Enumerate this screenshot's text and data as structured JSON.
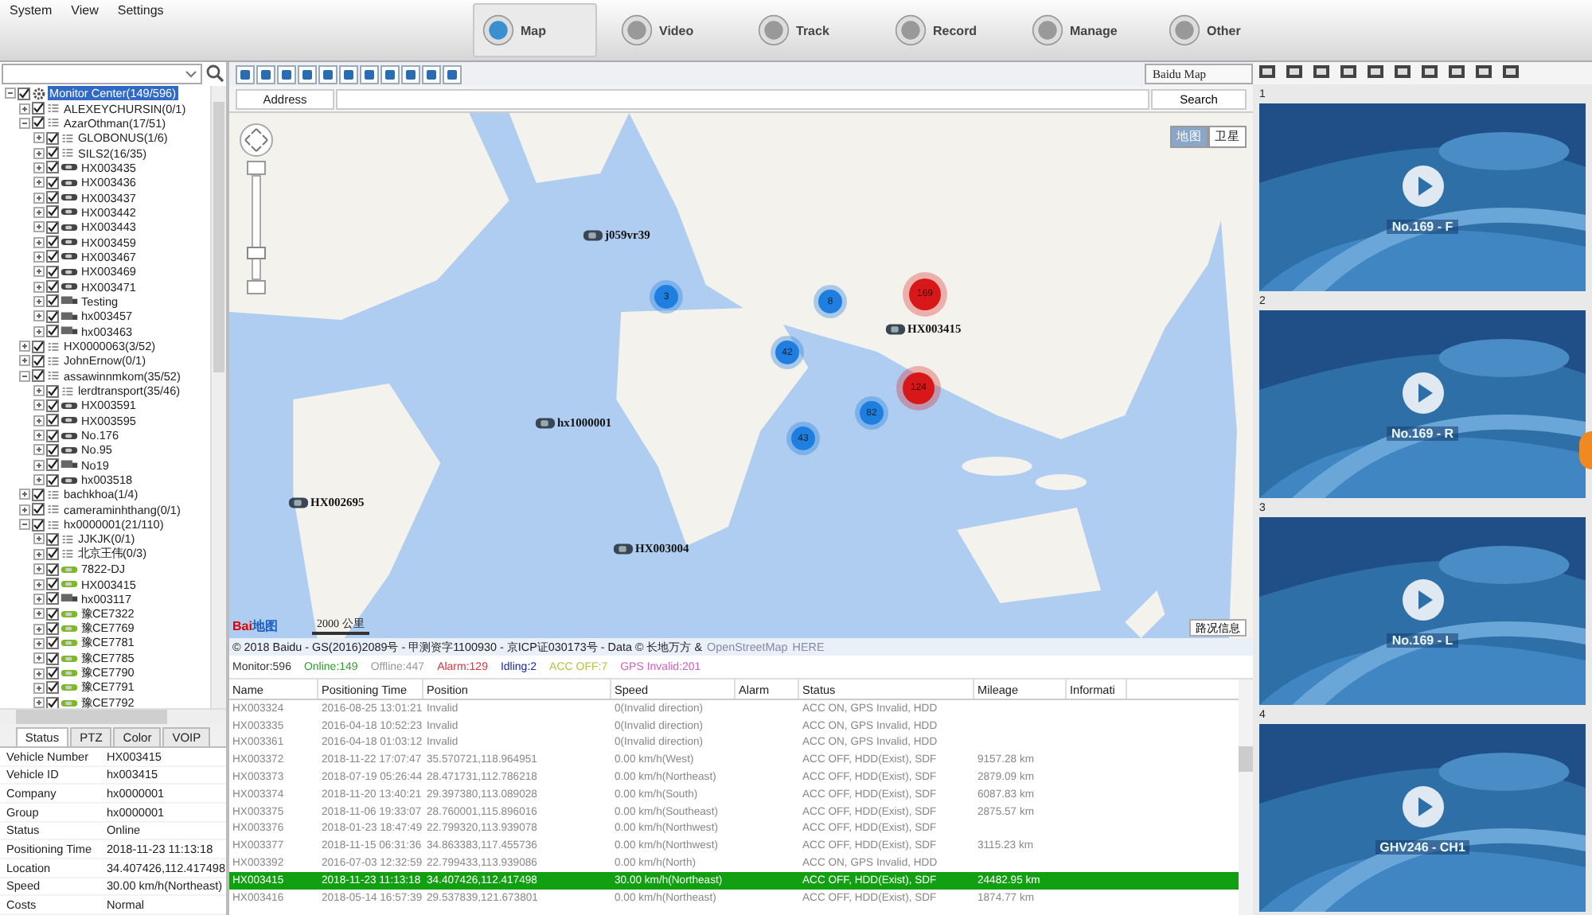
{
  "menu": [
    "System",
    "View",
    "Settings"
  ],
  "nav_tabs": [
    {
      "label": "Map",
      "selected": true
    },
    {
      "label": "Video",
      "selected": false
    },
    {
      "label": "Track",
      "selected": false
    },
    {
      "label": "Record",
      "selected": false
    },
    {
      "label": "Manage",
      "selected": false
    },
    {
      "label": "Other",
      "selected": false
    }
  ],
  "tree": [
    {
      "label": "Monitor Center(149/596)",
      "kind": "root",
      "checked": true,
      "expanded": true,
      "selected": true,
      "children": [
        {
          "label": "ALEXEYCHURSIN(0/1)",
          "kind": "group",
          "checked": true,
          "expanded": false,
          "selected": false
        },
        {
          "label": "AzarOthman(17/51)",
          "kind": "group",
          "checked": true,
          "expanded": true,
          "selected": false,
          "children": [
            {
              "label": "GLOBONUS(1/6)",
              "kind": "group",
              "checked": true,
              "expanded": false,
              "selected": false
            },
            {
              "label": "SILS2(16/35)",
              "kind": "group",
              "checked": true,
              "expanded": false,
              "selected": false
            },
            {
              "label": "HX003435",
              "kind": "car",
              "online": false,
              "checked": true,
              "expanded": false,
              "selected": false
            },
            {
              "label": "HX003436",
              "kind": "car",
              "online": false,
              "checked": true,
              "expanded": false,
              "selected": false
            },
            {
              "label": "HX003437",
              "kind": "car",
              "online": false,
              "checked": true,
              "expanded": false,
              "selected": false
            },
            {
              "label": "HX003442",
              "kind": "car",
              "online": false,
              "checked": true,
              "expanded": false,
              "selected": false
            },
            {
              "label": "HX003443",
              "kind": "car",
              "online": false,
              "checked": true,
              "expanded": false,
              "selected": false
            },
            {
              "label": "HX003459",
              "kind": "car",
              "online": false,
              "checked": true,
              "expanded": false,
              "selected": false
            },
            {
              "label": "HX003467",
              "kind": "car",
              "online": false,
              "checked": true,
              "expanded": false,
              "selected": false
            },
            {
              "label": "HX003469",
              "kind": "car",
              "online": false,
              "checked": true,
              "expanded": false,
              "selected": false
            },
            {
              "label": "HX003471",
              "kind": "car",
              "online": false,
              "checked": true,
              "expanded": false,
              "selected": false
            },
            {
              "label": "Testing",
              "kind": "truck",
              "online": false,
              "checked": true,
              "expanded": false,
              "selected": false
            },
            {
              "label": "hx003457",
              "kind": "truck",
              "online": false,
              "checked": true,
              "expanded": false,
              "selected": false
            },
            {
              "label": "hx003463",
              "kind": "truck",
              "online": false,
              "checked": true,
              "expanded": false,
              "selected": false
            }
          ]
        },
        {
          "label": "HX0000063(3/52)",
          "kind": "group",
          "checked": true,
          "expanded": false,
          "selected": false
        },
        {
          "label": "JohnErnow(0/1)",
          "kind": "group",
          "checked": true,
          "expanded": false,
          "selected": false
        },
        {
          "label": "assawinnmkom(35/52)",
          "kind": "group",
          "checked": true,
          "expanded": true,
          "selected": false,
          "children": [
            {
              "label": "lerdtransport(35/46)",
              "kind": "group",
              "checked": true,
              "expanded": false,
              "selected": false
            },
            {
              "label": "HX003591",
              "kind": "car",
              "online": false,
              "checked": true,
              "expanded": false,
              "selected": false
            },
            {
              "label": "HX003595",
              "kind": "car",
              "online": false,
              "checked": true,
              "expanded": false,
              "selected": false
            },
            {
              "label": "No.176",
              "kind": "car",
              "online": false,
              "checked": true,
              "expanded": false,
              "selected": false
            },
            {
              "label": "No.95",
              "kind": "car",
              "online": false,
              "checked": true,
              "expanded": false,
              "selected": false
            },
            {
              "label": "No19",
              "kind": "truck",
              "online": false,
              "checked": true,
              "expanded": false,
              "selected": false
            },
            {
              "label": "hx003518",
              "kind": "car",
              "online": false,
              "checked": true,
              "expanded": false,
              "selected": false
            }
          ]
        },
        {
          "label": "bachkhoa(1/4)",
          "kind": "group",
          "checked": true,
          "expanded": false,
          "selected": false
        },
        {
          "label": "cameraminhthang(0/1)",
          "kind": "group",
          "checked": true,
          "expanded": false,
          "selected": false
        },
        {
          "label": "hx0000001(21/110)",
          "kind": "group",
          "checked": true,
          "expanded": true,
          "selected": false,
          "children": [
            {
              "label": "JJKJK(0/1)",
              "kind": "group",
              "checked": true,
              "expanded": false,
              "selected": false
            },
            {
              "label": "北京王伟(0/3)",
              "kind": "group",
              "checked": true,
              "expanded": false,
              "selected": false
            },
            {
              "label": "7822-DJ",
              "kind": "car",
              "online": true,
              "checked": true,
              "expanded": false,
              "selected": false
            },
            {
              "label": "HX003415",
              "kind": "car",
              "online": true,
              "checked": true,
              "expanded": false,
              "selected": false
            },
            {
              "label": "hx003117",
              "kind": "truck",
              "online": false,
              "checked": true,
              "expanded": false,
              "selected": false
            },
            {
              "label": "豫CE7322",
              "kind": "car",
              "online": true,
              "checked": true,
              "expanded": false,
              "selected": false
            },
            {
              "label": "豫CE7769",
              "kind": "car",
              "online": true,
              "checked": true,
              "expanded": false,
              "selected": false
            },
            {
              "label": "豫CE7781",
              "kind": "car",
              "online": true,
              "checked": true,
              "expanded": false,
              "selected": false
            },
            {
              "label": "豫CE7785",
              "kind": "car",
              "online": true,
              "checked": true,
              "expanded": false,
              "selected": false
            },
            {
              "label": "豫CE7790",
              "kind": "car",
              "online": true,
              "checked": true,
              "expanded": false,
              "selected": false
            },
            {
              "label": "豫CE7791",
              "kind": "car",
              "online": true,
              "checked": true,
              "expanded": false,
              "selected": false
            },
            {
              "label": "豫CE7792",
              "kind": "car",
              "online": true,
              "checked": true,
              "expanded": false,
              "selected": false
            }
          ]
        }
      ]
    }
  ],
  "info_tabs": [
    {
      "label": "Status",
      "selected": true
    },
    {
      "label": "PTZ",
      "selected": false
    },
    {
      "label": "Color",
      "selected": false
    },
    {
      "label": "VOIP",
      "selected": false
    }
  ],
  "info": [
    {
      "label": "Vehicle Number",
      "value": "HX003415"
    },
    {
      "label": "Vehicle ID",
      "value": "hx003415"
    },
    {
      "label": "Company",
      "value": "hx0000001"
    },
    {
      "label": "Group",
      "value": "hx0000001"
    },
    {
      "label": "Status",
      "value": "Online"
    },
    {
      "label": "Positioning Time",
      "value": "2018-11-23 11:13:18"
    },
    {
      "label": "Location",
      "value": "34.407426,112.417498"
    },
    {
      "label": "Speed",
      "value": "30.00 km/h(Northeast)"
    },
    {
      "label": "Costs",
      "value": "Normal"
    }
  ],
  "map": {
    "type_select": "Baidu Map",
    "zoom": {
      "level": 0.22
    },
    "address_label": "Address",
    "search_button": "Search",
    "map_types": [
      {
        "label": "地图",
        "selected": true
      },
      {
        "label": "卫星",
        "selected": false
      }
    ],
    "clusters": [
      {
        "count": "3",
        "alarm": false
      },
      {
        "count": "8",
        "alarm": false
      },
      {
        "count": "42",
        "alarm": false
      },
      {
        "count": "82",
        "alarm": false
      },
      {
        "count": "43",
        "alarm": false
      },
      {
        "count": "169",
        "alarm": true
      },
      {
        "count": "124",
        "alarm": true
      }
    ],
    "markers": [
      {
        "label": "j059vr39"
      },
      {
        "label": "hx1000001"
      },
      {
        "label": "HX002695"
      },
      {
        "label": "HX003004"
      },
      {
        "label": "HX003415"
      }
    ],
    "logo": "Bai",
    "logo_suffix": "地图",
    "scale": "2000 公里",
    "traffic_button": "路况信息",
    "copyright": "© 2018 Baidu - GS(2016)2089号 - 甲测资字1100930 - 京ICP证030173号 - Data © 长地万方 & ",
    "copyright_links": [
      "OpenStreetMap",
      "HERE"
    ]
  },
  "stats": [
    {
      "label": "Monitor:596",
      "color": "#333333"
    },
    {
      "label": "Online:149",
      "color": "#2e9e2e"
    },
    {
      "label": "Offline:447",
      "color": "#999999"
    },
    {
      "label": "Alarm:129",
      "color": "#e0303a"
    },
    {
      "label": "Idling:2",
      "color": "#1a2a9a"
    },
    {
      "label": "ACC OFF:7",
      "color": "#b8c040"
    },
    {
      "label": "GPS Invalid:201",
      "color": "#d060c0"
    }
  ],
  "table": {
    "columns": [
      "Name",
      "Positioning Time",
      "Position",
      "Speed",
      "Alarm",
      "Status",
      "Mileage",
      "Informati"
    ],
    "rows": [
      {
        "selected": false,
        "cells": [
          "HX003324",
          "2016-08-25 13:01:21",
          "Invalid",
          "0(Invalid direction)",
          "",
          "ACC ON, GPS Invalid, HDD",
          ""
        ]
      },
      {
        "selected": false,
        "cells": [
          "HX003335",
          "2016-04-18 10:52:23",
          "Invalid",
          "0(Invalid direction)",
          "",
          "ACC ON, GPS Invalid, HDD",
          ""
        ]
      },
      {
        "selected": false,
        "cells": [
          "HX003361",
          "2016-04-18 01:03:12",
          "Invalid",
          "0(Invalid direction)",
          "",
          "ACC ON, GPS Invalid, HDD",
          ""
        ]
      },
      {
        "selected": false,
        "cells": [
          "HX003372",
          "2018-11-22 17:07:47",
          "35.570721,118.964951",
          "0.00 km/h(West)",
          "",
          "ACC OFF, HDD(Exist), SDF",
          "9157.28 km"
        ]
      },
      {
        "selected": false,
        "cells": [
          "HX003373",
          "2018-07-19 05:26:44",
          "28.471731,112.786218",
          "0.00 km/h(Northeast)",
          "",
          "ACC OFF, HDD(Exist), SDF",
          "2879.09 km"
        ]
      },
      {
        "selected": false,
        "cells": [
          "HX003374",
          "2018-11-20 13:40:21",
          "29.397380,113.089028",
          "0.00 km/h(South)",
          "",
          "ACC OFF, HDD(Exist), SDF",
          "6087.83 km"
        ]
      },
      {
        "selected": false,
        "cells": [
          "HX003375",
          "2018-11-06 19:33:07",
          "28.760001,115.896016",
          "0.00 km/h(Southeast)",
          "",
          "ACC OFF, HDD(Exist), SDF",
          "2875.57 km"
        ]
      },
      {
        "selected": false,
        "cells": [
          "HX003376",
          "2018-01-23 18:47:49",
          "22.799320,113.939078",
          "0.00 km/h(Northwest)",
          "",
          "ACC OFF, HDD(Exist), SDF",
          ""
        ]
      },
      {
        "selected": false,
        "cells": [
          "HX003377",
          "2018-11-15 06:31:36",
          "34.863383,117.455736",
          "0.00 km/h(Northwest)",
          "",
          "ACC OFF, HDD(Exist), SDF",
          "3115.23 km"
        ]
      },
      {
        "selected": false,
        "cells": [
          "HX003392",
          "2016-07-03 12:32:59",
          "22.799433,113.939086",
          "0.00 km/h(North)",
          "",
          "ACC ON, GPS Invalid, HDD",
          ""
        ]
      },
      {
        "selected": true,
        "cells": [
          "HX003415",
          "2018-11-23 11:13:18",
          "34.407426,112.417498",
          "30.00 km/h(Northeast)",
          "",
          "ACC OFF, HDD(Exist), SDF",
          "24482.95 km"
        ]
      },
      {
        "selected": false,
        "cells": [
          "HX003416",
          "2018-05-14 16:57:39",
          "29.537839,121.673801",
          "0.00 km/h(Northeast)",
          "",
          "ACC OFF, HDD(Exist), SDF",
          "1874.77 km"
        ]
      }
    ]
  },
  "videos": [
    {
      "number": "1",
      "caption": "No.169 - F"
    },
    {
      "number": "2",
      "caption": "No.169 - R"
    },
    {
      "number": "3",
      "caption": "No.169 - L"
    },
    {
      "number": "4",
      "caption": "GHV246 - CH1"
    }
  ]
}
